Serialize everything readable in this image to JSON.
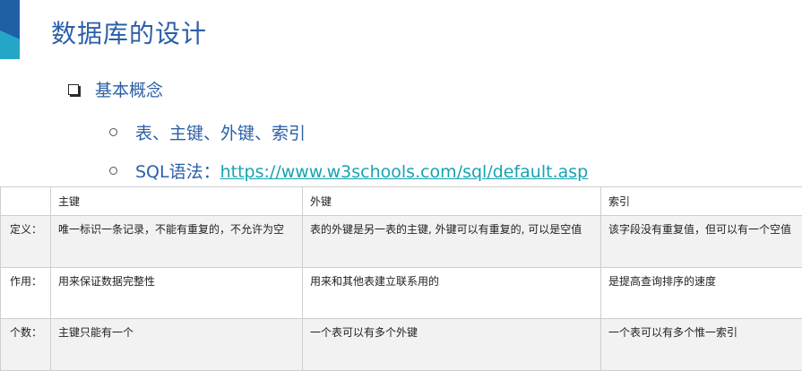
{
  "slide": {
    "title": "数据库的设计",
    "bullet_main": "基本概念",
    "sub1": "表、主键、外键、索引",
    "sub2_prefix": "SQL语法：",
    "sub2_link": "https://www.w3schools.com/sql/default.asp"
  },
  "table": {
    "headers": [
      "",
      "主键",
      "外键",
      "索引"
    ],
    "rows": [
      [
        "定义：",
        "唯一标识一条记录，不能有重复的，不允许为空",
        "表的外键是另一表的主键, 外键可以有重复的, 可以是空值",
        "该字段没有重复值，但可以有一个空值"
      ],
      [
        "作用：",
        "用来保证数据完整性",
        "用来和其他表建立联系用的",
        "是提高查询排序的速度"
      ],
      [
        "个数：",
        "主键只能有一个",
        "一个表可以有多个外键",
        "一个表可以有多个惟一索引"
      ]
    ]
  },
  "colors": {
    "title": "#2b5fa8",
    "link": "#17a3b0",
    "accent_dark": "#1f5fa6",
    "accent_light": "#25a6c8"
  }
}
